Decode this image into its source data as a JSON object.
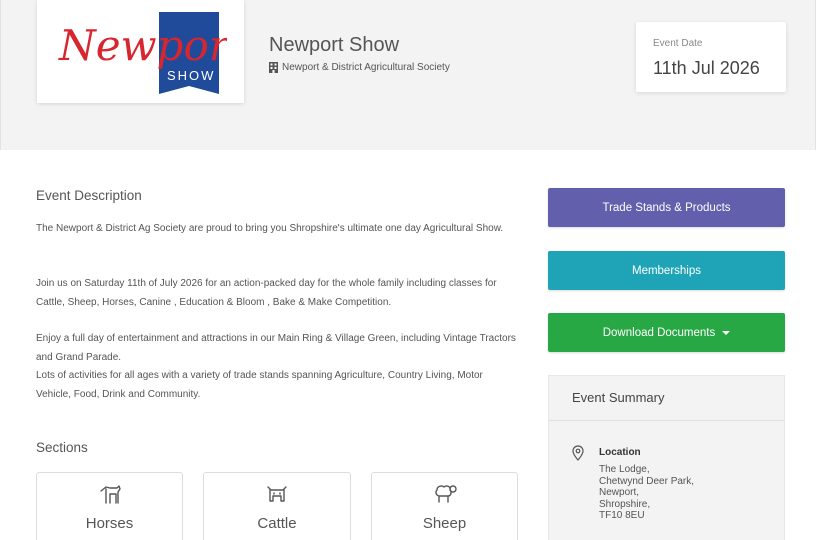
{
  "header": {
    "logo": {
      "text": "Newport",
      "sub": "SHOW",
      "colors": {
        "red": "#d7262e",
        "blue": "#1f4b9a"
      }
    },
    "title": "Newport Show",
    "organiser": "Newport & District Agricultural Society",
    "date_label": "Event Date",
    "date_value": "11th Jul 2026"
  },
  "description": {
    "title": "Event Description",
    "paragraphs": [
      "The Newport & District Ag Society are proud to bring you Shropshire's ultimate one day Agricultural Show.",
      "Join us on Saturday 11th of July 2026 for an action-packed day for the whole family including classes for Cattle, Sheep, Horses, Canine , Education & Bloom , Bake & Make Competition.",
      "Enjoy a full day of entertainment and attractions in our Main Ring & Village Green, including Vintage Tractors and Grand Parade.",
      "Lots of activities for all ages with a variety of trade stands spanning Agriculture, Country Living, Motor Vehicle, Food, Drink and Community."
    ]
  },
  "sections": {
    "title": "Sections",
    "items": [
      {
        "label": "Horses",
        "icon": "horse-icon"
      },
      {
        "label": "Cattle",
        "icon": "cow-icon"
      },
      {
        "label": "Sheep",
        "icon": "sheep-icon"
      }
    ]
  },
  "actions": {
    "trade": {
      "label": "Trade Stands & Products",
      "color": "#6260ad"
    },
    "memberships": {
      "label": "Memberships",
      "color": "#1fa4b7"
    },
    "documents": {
      "label": "Download Documents",
      "color": "#27a844"
    }
  },
  "summary": {
    "title": "Event Summary",
    "location_label": "Location",
    "location_lines": [
      "The Lodge,",
      "Chetwynd Deer Park,",
      "Newport,",
      "Shropshire,",
      "TF10 8EU"
    ]
  }
}
